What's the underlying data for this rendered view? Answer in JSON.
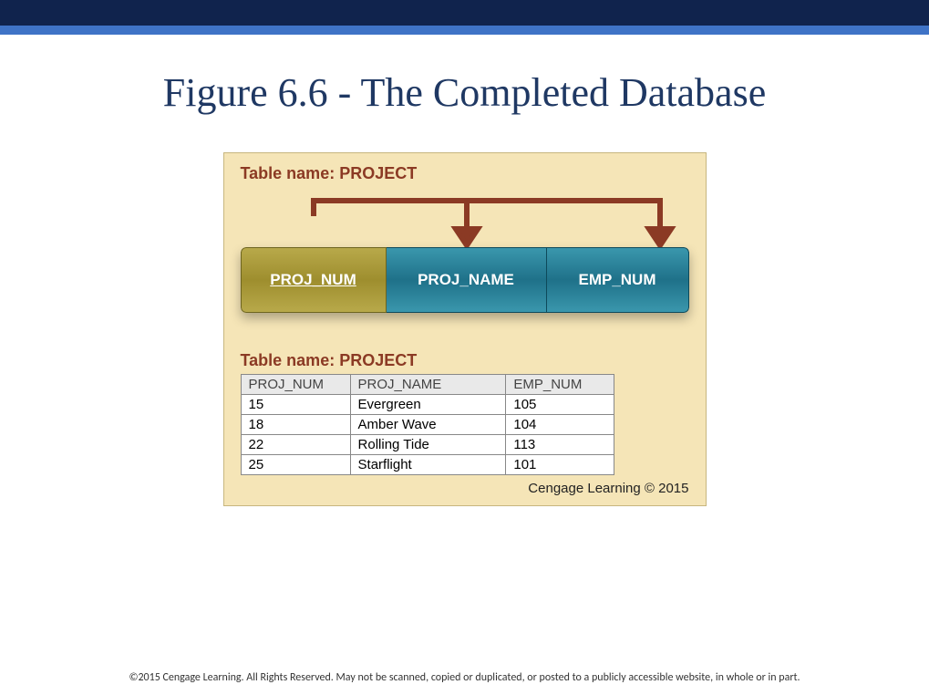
{
  "title": "Figure 6.6 - The Completed Database",
  "label1": "Table name: PROJECT",
  "headers": {
    "pk": "PROJ_NUM",
    "name": "PROJ_NAME",
    "emp": "EMP_NUM"
  },
  "label2": "Table name: PROJECT",
  "columns": {
    "c0": "PROJ_NUM",
    "c1": "PROJ_NAME",
    "c2": "EMP_NUM"
  },
  "rows": {
    "r0": {
      "c0": "15",
      "c1": "Evergreen",
      "c2": "105"
    },
    "r1": {
      "c0": "18",
      "c1": "Amber Wave",
      "c2": "104"
    },
    "r2": {
      "c0": "22",
      "c1": "Rolling Tide",
      "c2": "113"
    },
    "r3": {
      "c0": "25",
      "c1": "Starflight",
      "c2": "101"
    }
  },
  "credit": "Cengage Learning © 2015",
  "footer": "©2015 Cengage Learning. All Rights Reserved. May not be scanned, copied or duplicated, or posted to a publicly accessible website, in whole or in part."
}
